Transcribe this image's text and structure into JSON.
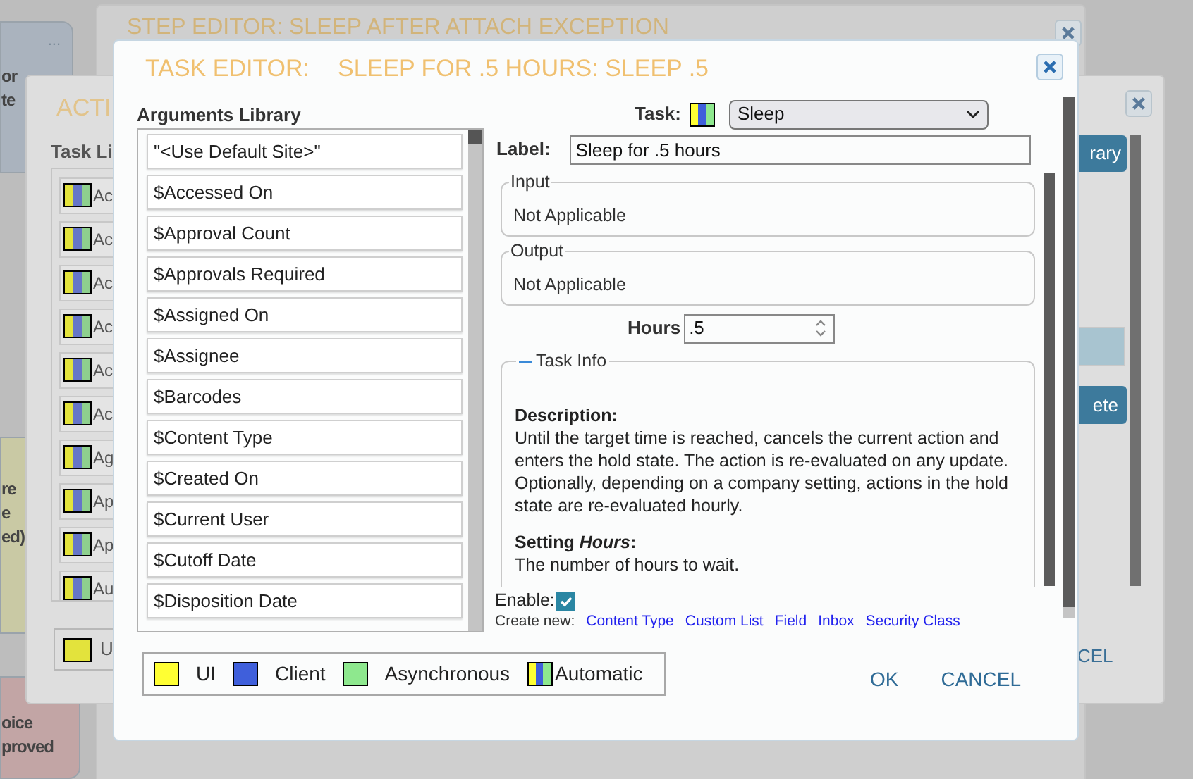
{
  "canvas_cards": [
    {
      "kind": "top",
      "lines": [
        "or",
        "te"
      ],
      "menu": "...",
      "color": "#aab3be"
    },
    {
      "kind": "middle",
      "lines": [
        "re",
        "e",
        "ed)"
      ],
      "color": "#c9c9a4"
    },
    {
      "kind": "bottom",
      "lines": [
        "oice",
        "proved"
      ],
      "color": "#c2a5a5"
    }
  ],
  "step_editor": {
    "title": "STEP EDITOR: SLEEP AFTER ATTACH EXCEPTION"
  },
  "action_editor": {
    "title": "ACTI",
    "task_library_heading": "Task Li",
    "tasks": [
      {
        "label": "Ac"
      },
      {
        "label": "Ac"
      },
      {
        "label": "Ac"
      },
      {
        "label": "Ac"
      },
      {
        "label": "Ac"
      },
      {
        "label": "Ac"
      },
      {
        "label": "Ag"
      },
      {
        "label": "Ap"
      },
      {
        "label": "Ap"
      },
      {
        "label": "Au"
      }
    ],
    "legend_label": "U",
    "library_button": "rary",
    "delete_button": "ete",
    "cancel_button": "CEL"
  },
  "task_editor": {
    "title_prefix": "TASK EDITOR:",
    "title": "SLEEP FOR .5 HOURS: SLEEP .5",
    "arguments_heading": "Arguments Library",
    "arguments": [
      "\"<Use Default Site>\"",
      "$Accessed On",
      "$Approval Count",
      "$Approvals Required",
      "$Assigned On",
      "$Assignee",
      "$Barcodes",
      "$Content Type",
      "$Created On",
      "$Current User",
      "$Cutoff Date",
      "$Disposition Date"
    ],
    "task_label": "Task:",
    "task_value": "Sleep",
    "label_label": "Label:",
    "label_value": "Sleep for .5 hours",
    "sections": [
      {
        "legend": "Input",
        "text": "Not Applicable"
      },
      {
        "legend": "Output",
        "text": "Not Applicable"
      }
    ],
    "hours_label": "Hours",
    "hours_value": ".5",
    "task_info": {
      "legend": "Task Info",
      "expanded": true,
      "description_heading": "Description:",
      "description": "Until the target time is reached, cancels the current action and enters the hold state. The action is re-evaluated on any update. Optionally, depending on a company setting, actions in the hold state are re-evaluated hourly.",
      "setting_heading": "Setting *Hours*:",
      "setting_text": "The number of hours to wait."
    },
    "enable_label": "Enable:",
    "enable_checked": true,
    "create_new_label": "Create new:",
    "create_new_links": [
      "Content Type",
      "Custom List",
      "Field",
      "Inbox",
      "Security Class"
    ],
    "legend": [
      {
        "kind": "ui",
        "label": "UI"
      },
      {
        "kind": "client",
        "label": "Client"
      },
      {
        "kind": "async",
        "label": "Asynchronous"
      },
      {
        "kind": "automatic",
        "label": "Automatic"
      }
    ],
    "buttons": [
      "OK",
      "CANCEL"
    ]
  }
}
